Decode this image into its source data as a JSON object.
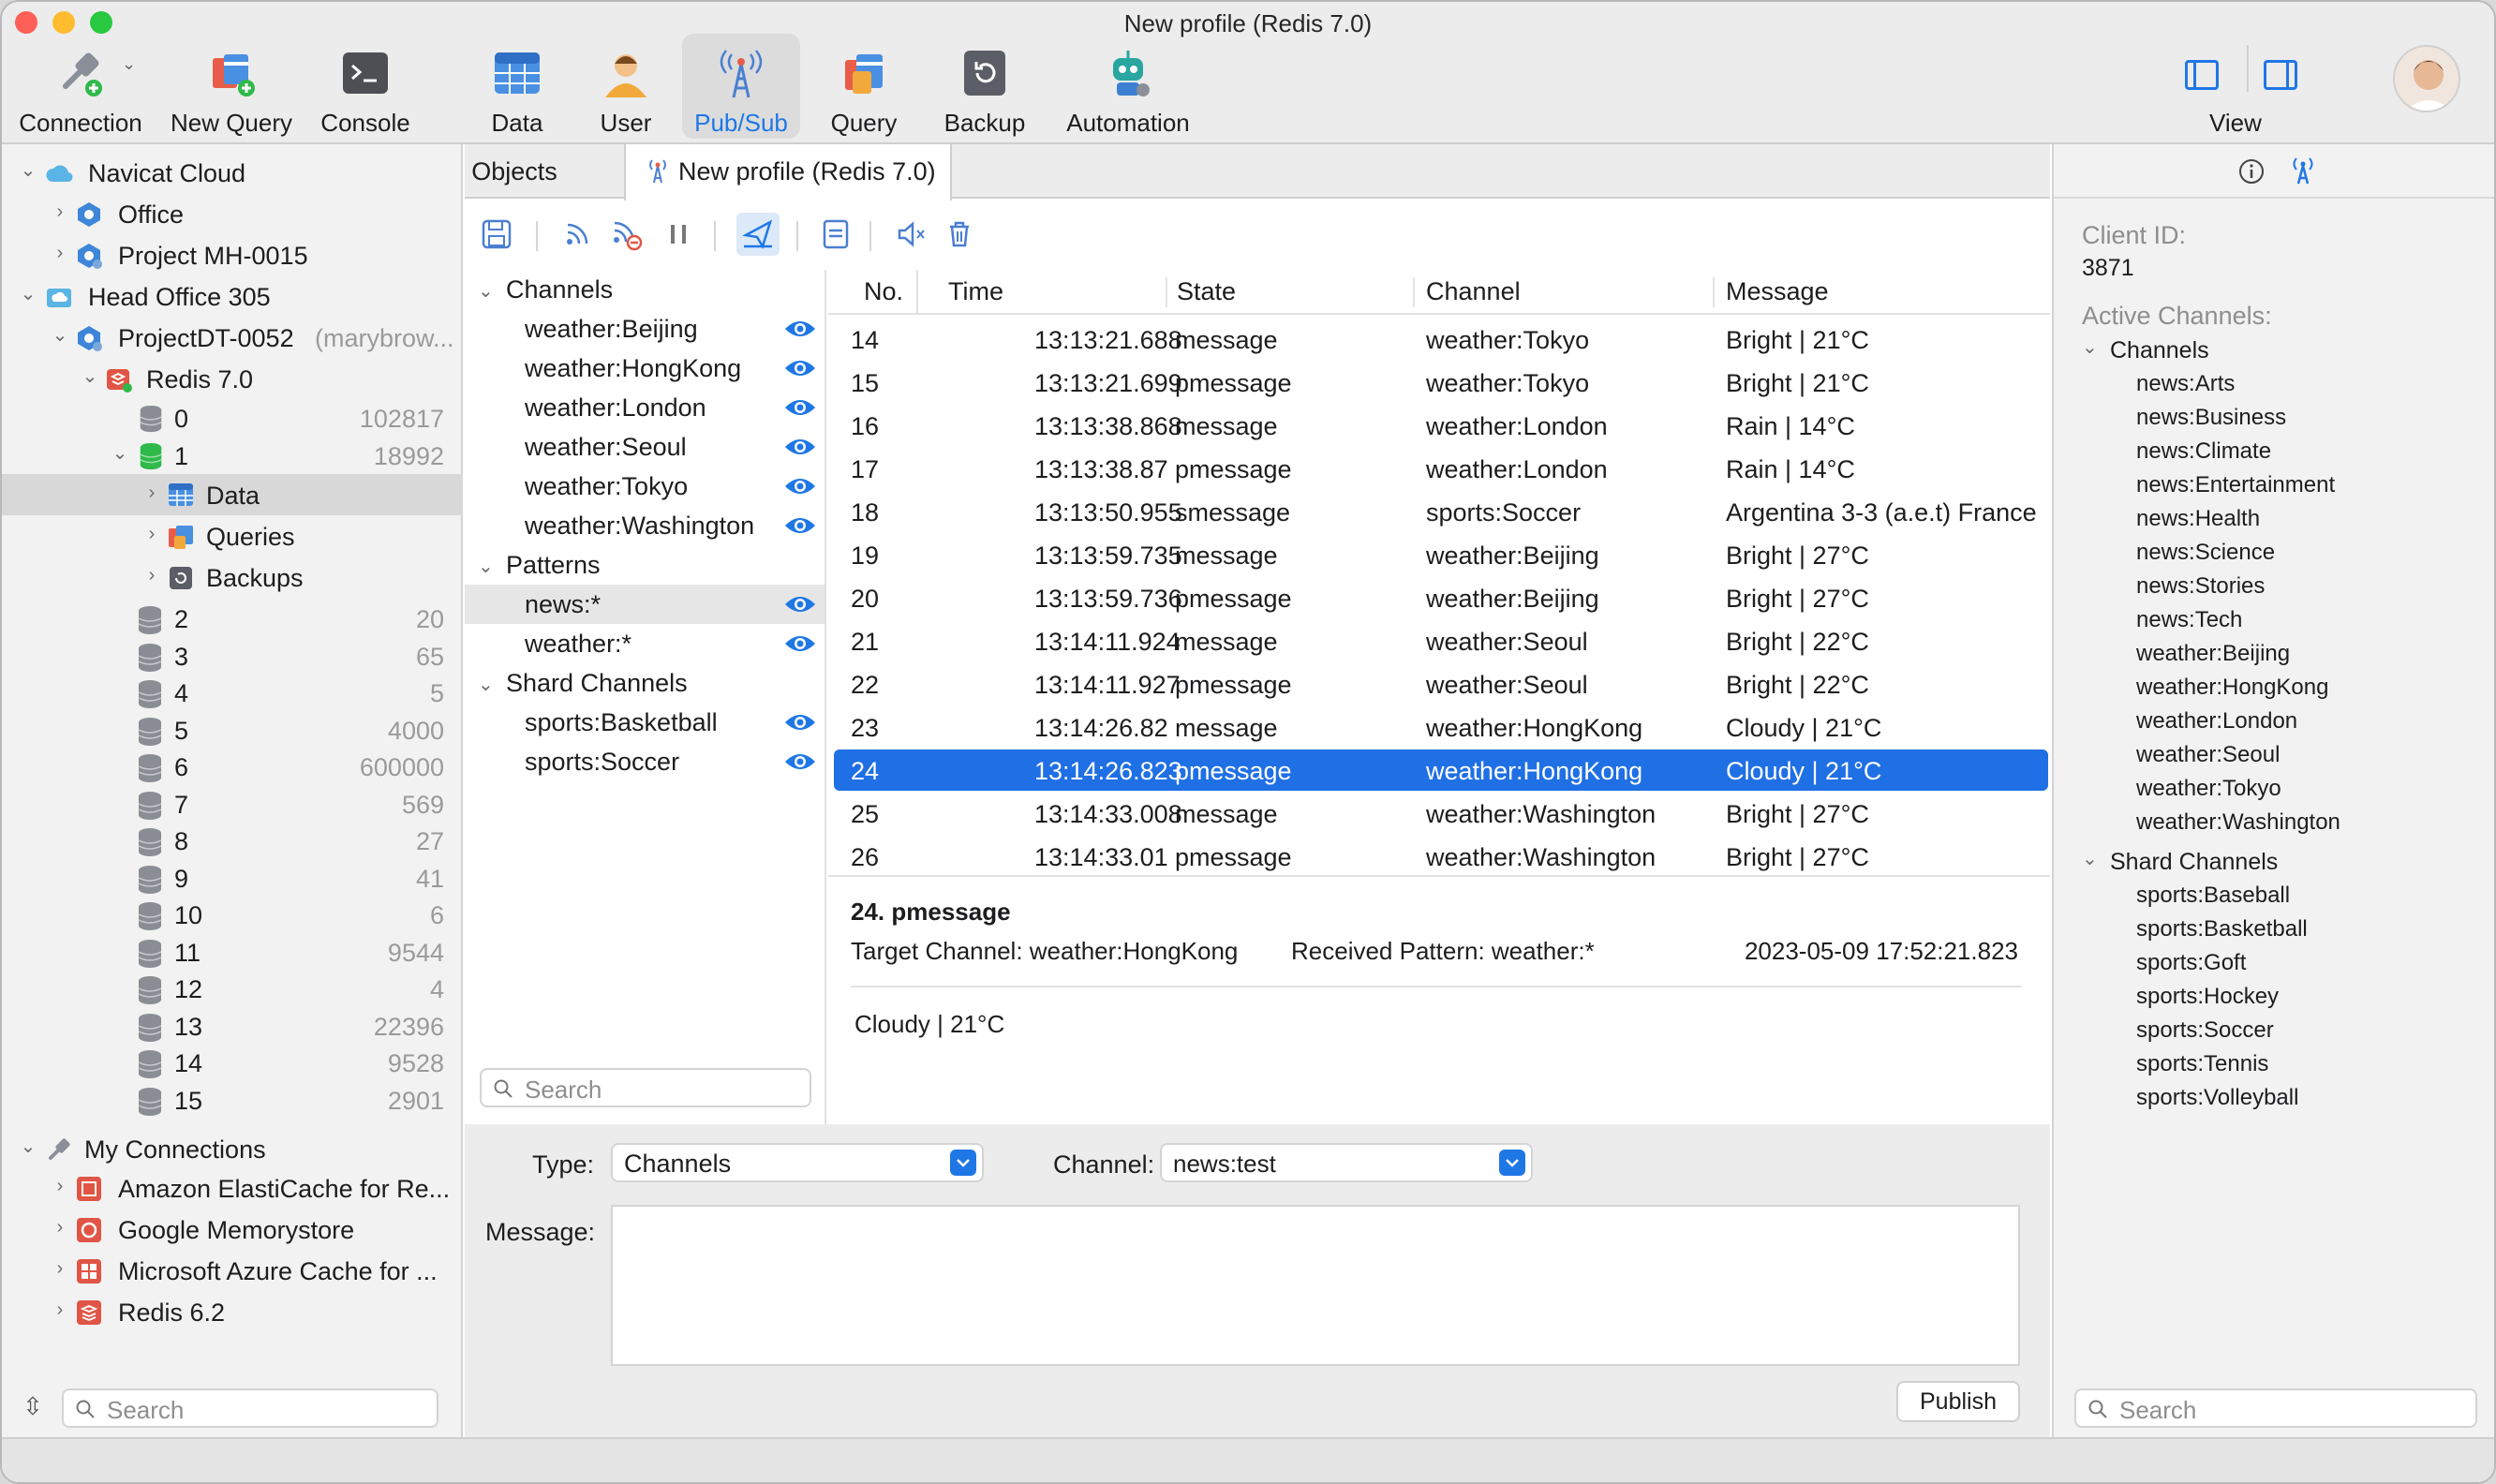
{
  "window": {
    "title": "New profile (Redis 7.0)"
  },
  "toolbar": {
    "connection": "Connection",
    "new_query": "New Query",
    "console": "Console",
    "data": "Data",
    "user": "User",
    "pubsub": "Pub/Sub",
    "query": "Query",
    "backup": "Backup",
    "automation": "Automation",
    "view": "View"
  },
  "sidebar": {
    "navicat_cloud": "Navicat Cloud",
    "office": "Office",
    "project_mh": "Project MH-0015",
    "head_office": "Head Office 305",
    "project_dt": "ProjectDT-0052",
    "project_dt_owner": "(marybrow...",
    "redis7": "Redis 7.0",
    "data": "Data",
    "queries": "Queries",
    "backups": "Backups",
    "databases": [
      {
        "name": "0",
        "count": "102817"
      },
      {
        "name": "1",
        "count": "18992"
      },
      {
        "name": "2",
        "count": "20"
      },
      {
        "name": "3",
        "count": "65"
      },
      {
        "name": "4",
        "count": "5"
      },
      {
        "name": "5",
        "count": "4000"
      },
      {
        "name": "6",
        "count": "600000"
      },
      {
        "name": "7",
        "count": "569"
      },
      {
        "name": "8",
        "count": "27"
      },
      {
        "name": "9",
        "count": "41"
      },
      {
        "name": "10",
        "count": "6"
      },
      {
        "name": "11",
        "count": "9544"
      },
      {
        "name": "12",
        "count": "4"
      },
      {
        "name": "13",
        "count": "22396"
      },
      {
        "name": "14",
        "count": "9528"
      },
      {
        "name": "15",
        "count": "2901"
      }
    ],
    "my_connections": "My Connections",
    "connections": [
      "Amazon ElastiCache for Re...",
      "Google Memorystore",
      "Microsoft Azure Cache for ...",
      "Redis 6.2"
    ],
    "search_placeholder": "Search"
  },
  "tabs": {
    "objects": "Objects",
    "profile": "New profile (Redis 7.0)"
  },
  "channels_panel": {
    "channels_header": "Channels",
    "channels": [
      "weather:Beijing",
      "weather:HongKong",
      "weather:London",
      "weather:Seoul",
      "weather:Tokyo",
      "weather:Washington"
    ],
    "patterns_header": "Patterns",
    "patterns": [
      "news:*",
      "weather:*"
    ],
    "shard_header": "Shard Channels",
    "shard": [
      "sports:Basketball",
      "sports:Soccer"
    ],
    "search_placeholder": "Search"
  },
  "table": {
    "columns": [
      "No.",
      "Time",
      "State",
      "Channel",
      "Message"
    ],
    "rows": [
      [
        "14",
        "13:13:21.688",
        "message",
        "weather:Tokyo",
        "Bright | 21°C"
      ],
      [
        "15",
        "13:13:21.699",
        "pmessage",
        "weather:Tokyo",
        "Bright | 21°C"
      ],
      [
        "16",
        "13:13:38.868",
        "message",
        "weather:London",
        "Rain | 14°C"
      ],
      [
        "17",
        "13:13:38.87",
        "pmessage",
        "weather:London",
        "Rain | 14°C"
      ],
      [
        "18",
        "13:13:50.955",
        "smessage",
        "sports:Soccer",
        "Argentina 3-3 (a.e.t) France"
      ],
      [
        "19",
        "13:13:59.735",
        "message",
        "weather:Beijing",
        "Bright | 27°C"
      ],
      [
        "20",
        "13:13:59.736",
        "pmessage",
        "weather:Beijing",
        "Bright | 27°C"
      ],
      [
        "21",
        "13:14:11.924",
        "message",
        "weather:Seoul",
        "Bright | 22°C"
      ],
      [
        "22",
        "13:14:11.927",
        "pmessage",
        "weather:Seoul",
        "Bright | 22°C"
      ],
      [
        "23",
        "13:14:26.82",
        "message",
        "weather:HongKong",
        "Cloudy | 21°C"
      ],
      [
        "24",
        "13:14:26.823",
        "pmessage",
        "weather:HongKong",
        "Cloudy | 21°C"
      ],
      [
        "25",
        "13:14:33.008",
        "message",
        "weather:Washington",
        "Bright | 27°C"
      ],
      [
        "26",
        "13:14:33.01",
        "pmessage",
        "weather:Washington",
        "Bright | 27°C"
      ]
    ]
  },
  "detail": {
    "title": "24. pmessage",
    "target_channel": "Target Channel: weather:HongKong",
    "received_pattern": "Received Pattern: weather:*",
    "timestamp": "2023-05-09 17:52:21.823",
    "body": "Cloudy | 21°C"
  },
  "publish": {
    "type_label": "Type:",
    "type_value": "Channels",
    "channel_label": "Channel:",
    "channel_value": "news:test",
    "message_label": "Message:",
    "message_value": "",
    "publish_button": "Publish"
  },
  "right_panel": {
    "client_id_label": "Client ID:",
    "client_id": "3871",
    "active_channels_label": "Active Channels:",
    "channels_header": "Channels",
    "channels": [
      "news:Arts",
      "news:Business",
      "news:Climate",
      "news:Entertainment",
      "news:Health",
      "news:Science",
      "news:Stories",
      "news:Tech",
      "weather:Beijing",
      "weather:HongKong",
      "weather:London",
      "weather:Seoul",
      "weather:Tokyo",
      "weather:Washington"
    ],
    "shard_header": "Shard Channels",
    "shard": [
      "sports:Baseball",
      "sports:Basketball",
      "sports:Goft",
      "sports:Hockey",
      "sports:Soccer",
      "sports:Tennis",
      "sports:Volleyball"
    ],
    "search_placeholder": "Search"
  },
  "colors": {
    "accent": "#1f77e6",
    "selection": "#1f6fe5"
  }
}
